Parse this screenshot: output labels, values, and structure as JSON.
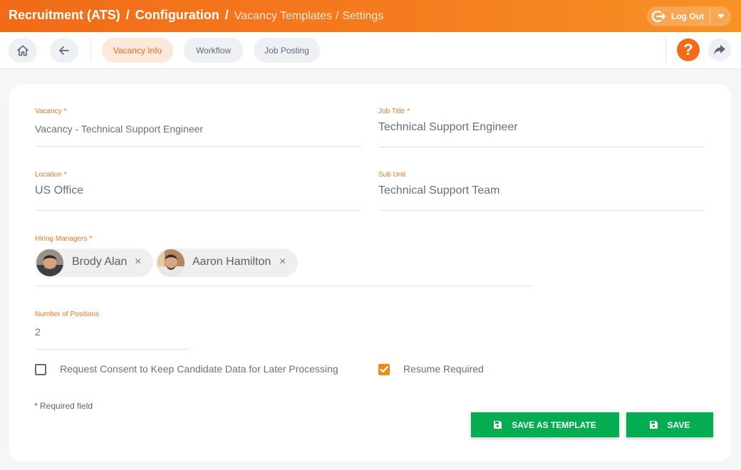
{
  "header": {
    "crumb_main": "Recruitment (ATS)",
    "crumb_config": "Configuration",
    "crumb_templates": "Vacancy Templates",
    "crumb_settings": "Settings",
    "sep": "/",
    "logout_label": "Log Out"
  },
  "toolbar": {
    "tabs": [
      {
        "label": "Vacancy Info",
        "active": true
      },
      {
        "label": "Workflow",
        "active": false
      },
      {
        "label": "Job Posting",
        "active": false
      }
    ],
    "help_label": "?"
  },
  "form": {
    "vacancy": {
      "label": "Vacancy",
      "value": "Vacancy - Technical Support Engineer",
      "required": true
    },
    "job_title": {
      "label": "Job Title",
      "value": "Technical Support Engineer",
      "required": true
    },
    "location": {
      "label": "Location",
      "value": "US Office",
      "required": true
    },
    "sub_unit": {
      "label": "Sub Unit",
      "value": "Technical Support Team",
      "required": false
    },
    "hiring_managers": {
      "label": "Hiring Managers",
      "required": true,
      "chips": [
        "Brody Alan",
        "Aaron Hamilton"
      ],
      "remove_glyph": "×"
    },
    "positions": {
      "label": "Number of Positions",
      "value": "2"
    },
    "consent": {
      "label": "Request Consent to Keep Candidate Data for Later Processing",
      "checked": false
    },
    "resume": {
      "label": "Resume Required",
      "checked": true
    },
    "required_star": "*"
  },
  "footer": {
    "required_note": "* Required field",
    "save_template_label": "SAVE AS TEMPLATE",
    "save_label": "SAVE"
  },
  "colors": {
    "accent": "#f26b18",
    "save_green": "#04ad52"
  }
}
